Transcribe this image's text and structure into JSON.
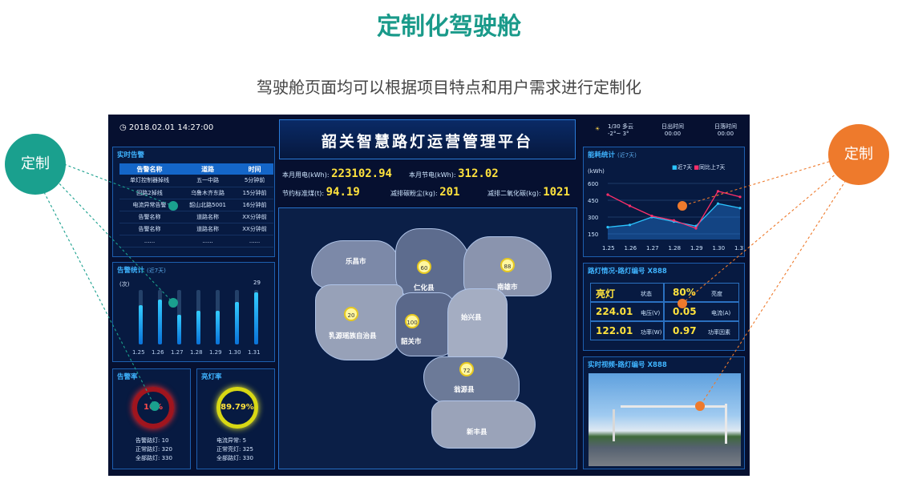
{
  "page": {
    "title": "定制化驾驶舱",
    "subtitle": "驾驶舱页面均可以根据项目特点和用户需求进行定制化",
    "bubble_left": "定制",
    "bubble_right": "定制"
  },
  "dashboard": {
    "datetime": "2018.02.01    14:27:00",
    "header_title": "韶关智慧路灯运营管理平台",
    "weather": {
      "text": "1/30 多云",
      "temp": "-2°~ 3°",
      "sunrise_label": "日出时间",
      "sunrise": "00:00",
      "sunset_label": "日落时间",
      "sunset": "00:00"
    },
    "stats": {
      "month_power_label": "本月用电(kWh):",
      "month_power": "223102.94",
      "month_saving_label": "本月节电(kWh):",
      "month_saving": "312.02",
      "coal_label": "节约标准煤(t):",
      "coal": "94.19",
      "carbon_dust_label": "减排碳粉尘(kg):",
      "carbon_dust": "201",
      "co2_label": "减排二氧化碳(kg):",
      "co2": "1021"
    },
    "alarm_panel": {
      "title": "实时告警",
      "headers": [
        "告警名称",
        "道路",
        "时间"
      ],
      "rows": [
        [
          "单灯控制器掉线",
          "五一中路",
          "5分钟前"
        ],
        [
          "回路2掉线",
          "乌鲁木齐东路",
          "15分钟前"
        ],
        [
          "电流异常告警",
          "韶山北路5001",
          "16分钟前"
        ],
        [
          "告警名称",
          "道路名称",
          "XX分钟前"
        ],
        [
          "告警名称",
          "道路名称",
          "XX分钟前"
        ],
        [
          "......",
          "......",
          "......"
        ]
      ]
    },
    "alarm_stats": {
      "title": "告警统计",
      "subtitle": "(近7天)",
      "unit": "(次)",
      "categories": [
        "1.25",
        "1.26",
        "1.27",
        "1.28",
        "1.29",
        "1.30",
        "1.31"
      ],
      "values": [
        0.72,
        0.82,
        0.55,
        0.62,
        0.62,
        0.78,
        0.95
      ],
      "max_label": "29"
    },
    "alarm_rate": {
      "title": "告警率",
      "value": "10%",
      "lines": [
        "告警路灯: 10",
        "正常路灯: 320",
        "全部路灯: 330"
      ]
    },
    "light_rate": {
      "title": "亮灯率",
      "value": "89.79%",
      "lines": [
        "电流异常: 5",
        "正常亮灯: 325",
        "全部路灯: 330"
      ]
    },
    "map": {
      "cities": [
        "乐昌市",
        "仁化县",
        "南雄市",
        "始兴县",
        "乳源瑶族自治县",
        "韶关市",
        "翁源县",
        "新丰县"
      ],
      "bulbs": [
        "60",
        "88",
        "20",
        "100",
        "72"
      ]
    },
    "energy_panel": {
      "title": "能耗统计",
      "subtitle": "(近7天)",
      "unit": "(kWh)",
      "legend": [
        "近7天",
        "同比上7天"
      ],
      "yticks": [
        "600",
        "450",
        "300",
        "150"
      ],
      "xticks": [
        "1.25",
        "1.26",
        "1.27",
        "1.28",
        "1.29",
        "1.30",
        "1.31"
      ]
    },
    "light_status": {
      "title": "路灯情况-路灯编号 X888",
      "cells": [
        {
          "value": "亮灯",
          "key": "状态"
        },
        {
          "value": "80%",
          "key": "亮度"
        },
        {
          "value": "224.01",
          "key": "电压(V)"
        },
        {
          "value": "0.05",
          "key": "电流(A)"
        },
        {
          "value": "122.01",
          "key": "功率(W)"
        },
        {
          "value": "0.97",
          "key": "功率因素"
        }
      ]
    },
    "video_panel": {
      "title": "实时视频-路灯编号 X888"
    }
  },
  "chart_data": {
    "type": "line",
    "title": "能耗统计",
    "ylabel": "(kWh)",
    "categories": [
      "1.25",
      "1.26",
      "1.27",
      "1.28",
      "1.29",
      "1.30",
      "1.31"
    ],
    "ylim": [
      100,
      650
    ],
    "series": [
      {
        "name": "近7天",
        "values": [
          210,
          230,
          300,
          260,
          220,
          420,
          380
        ]
      },
      {
        "name": "同比上7天",
        "values": [
          500,
          400,
          310,
          270,
          200,
          530,
          480
        ]
      }
    ]
  },
  "colors": {
    "teal": "#1aa08e",
    "orange": "#ee7a2c",
    "accent_blue": "#3fb4ff",
    "yellow": "#ffe23d"
  }
}
